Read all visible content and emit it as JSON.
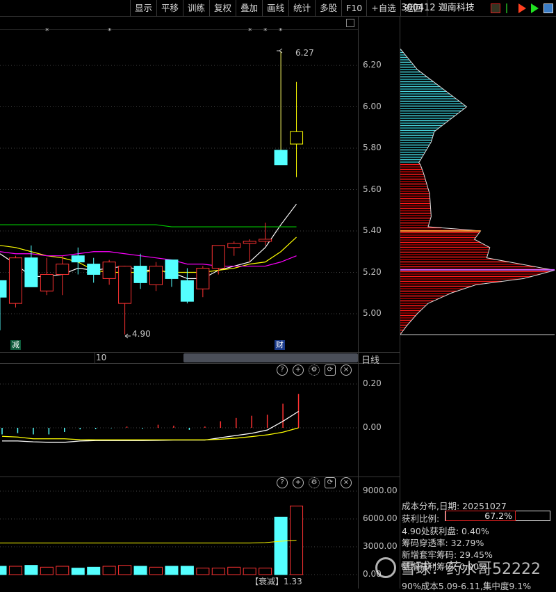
{
  "toolbar": {
    "buttons": [
      "显示",
      "平移",
      "训练",
      "复权",
      "叠加",
      "画线",
      "统计",
      "多股",
      "F10",
      "+自选",
      "返回"
    ],
    "stock": "300412 迦南科技",
    "icons": [
      "chip-distribution-icon",
      "flag-green-icon",
      "flag-red-icon",
      "flag-green-play-icon",
      "window-icon"
    ]
  },
  "main": {
    "price_axis": [
      "6.20",
      "6.00",
      "5.80",
      "5.60",
      "5.40",
      "5.20",
      "5.00"
    ],
    "high_label": "6.27",
    "low_label": "4.90",
    "badge_left": "减",
    "badge_right": "财",
    "stars": [
      "*",
      "*",
      "*",
      "*",
      "*"
    ],
    "date_tick": "10",
    "period": "日线",
    "colors": {
      "up": "#ff3232",
      "down": "#54ffff",
      "ma5": "#ffffff",
      "ma10": "#ffff00",
      "ma20": "#ff00ff",
      "ma60": "#00cc00"
    }
  },
  "chart_data": [
    {
      "type": "candlestick",
      "title": "300412 迦南科技 日线",
      "ylim": [
        4.87,
        6.3
      ],
      "ohlc": [
        [
          5.16,
          5.16,
          4.92,
          5.08
        ],
        [
          5.05,
          5.28,
          5.03,
          5.27
        ],
        [
          5.27,
          5.33,
          5.13,
          5.13
        ],
        [
          5.11,
          5.27,
          5.09,
          5.19
        ],
        [
          5.19,
          5.28,
          5.09,
          5.24
        ],
        [
          5.28,
          5.32,
          5.19,
          5.25
        ],
        [
          5.24,
          5.27,
          5.15,
          5.19
        ],
        [
          5.17,
          5.26,
          5.14,
          5.25
        ],
        [
          5.05,
          5.23,
          4.9,
          5.23
        ],
        [
          5.23,
          5.29,
          5.12,
          5.15
        ],
        [
          5.14,
          5.25,
          5.11,
          5.23
        ],
        [
          5.26,
          5.26,
          5.13,
          5.17
        ],
        [
          5.16,
          5.22,
          5.05,
          5.06
        ],
        [
          5.12,
          5.23,
          5.08,
          5.22
        ],
        [
          5.22,
          5.33,
          5.19,
          5.33
        ],
        [
          5.32,
          5.35,
          5.28,
          5.34
        ],
        [
          5.34,
          5.36,
          5.25,
          5.35
        ],
        [
          5.35,
          5.44,
          5.33,
          5.36
        ],
        [
          5.79,
          6.27,
          5.72,
          5.72
        ],
        [
          5.82,
          6.12,
          5.66,
          5.88
        ]
      ],
      "series": [
        {
          "name": "MA5",
          "values": [
            5.29,
            5.24,
            5.18,
            5.18,
            5.19,
            5.22,
            5.21,
            5.22,
            5.23,
            5.21,
            5.21,
            5.2,
            5.17,
            5.17,
            5.21,
            5.23,
            5.25,
            5.32,
            5.43,
            5.53
          ]
        },
        {
          "name": "MA10",
          "values": [
            5.33,
            5.32,
            5.3,
            5.28,
            5.27,
            5.25,
            5.21,
            5.2,
            5.2,
            5.2,
            5.21,
            5.2,
            5.2,
            5.2,
            5.21,
            5.22,
            5.24,
            5.25,
            5.3,
            5.37
          ]
        },
        {
          "name": "MA20",
          "values": [
            5.3,
            5.29,
            5.29,
            5.28,
            5.28,
            5.29,
            5.3,
            5.3,
            5.29,
            5.28,
            5.27,
            5.26,
            5.24,
            5.24,
            5.23,
            5.23,
            5.23,
            5.23,
            5.25,
            5.28
          ]
        },
        {
          "name": "MA60",
          "values": [
            5.43,
            5.43,
            5.43,
            5.43,
            5.43,
            5.43,
            5.43,
            5.43,
            5.43,
            5.43,
            5.43,
            5.42,
            5.42,
            5.42,
            5.42,
            5.42,
            5.42,
            5.42,
            5.42,
            5.42
          ]
        }
      ]
    },
    {
      "type": "bar",
      "title": "indicator",
      "ylim": [
        -0.11,
        0.25
      ],
      "ticks": [
        "0.20",
        "0.00"
      ],
      "values": [
        -0.03,
        -0.024,
        -0.03,
        -0.03,
        -0.019,
        -0.007,
        -0.006,
        -0.002,
        0.006,
        -0.004,
        0.014,
        0.01,
        -0.009,
        0.006,
        0.03,
        0.045,
        0.055,
        0.06,
        0.11,
        0.155
      ],
      "series": [
        {
          "name": "white",
          "values": [
            -0.06,
            -0.06,
            -0.064,
            -0.066,
            -0.066,
            -0.06,
            -0.058,
            -0.058,
            -0.058,
            -0.058,
            -0.057,
            -0.056,
            -0.056,
            -0.056,
            -0.045,
            -0.035,
            -0.025,
            -0.01,
            0.03,
            0.075
          ]
        },
        {
          "name": "yellow",
          "values": [
            -0.039,
            -0.042,
            -0.05,
            -0.05,
            -0.05,
            -0.054,
            -0.055,
            -0.055,
            -0.055,
            -0.055,
            -0.055,
            -0.055,
            -0.055,
            -0.055,
            -0.052,
            -0.047,
            -0.04,
            -0.032,
            -0.02,
            0.0
          ]
        }
      ]
    },
    {
      "type": "bar",
      "title": "volume",
      "ylim": [
        0,
        9000
      ],
      "ticks": [
        "9000.00",
        "6000.00",
        "3000.00",
        "0.00"
      ],
      "values": [
        900,
        900,
        1000,
        800,
        900,
        700,
        800,
        900,
        1000,
        900,
        800,
        900,
        900,
        700,
        700,
        800,
        700,
        700,
        6200,
        7400
      ],
      "series": [
        {
          "name": "MAVOL",
          "values": [
            3400,
            3400,
            3400,
            3400,
            3400,
            3400,
            3400,
            3400,
            3400,
            3400,
            3400,
            3400,
            3400,
            3400,
            3400,
            3400,
            3400,
            3450,
            3600,
            3700
          ]
        }
      ],
      "label": "【衰减】1.33"
    },
    {
      "type": "area",
      "title": "成本分布",
      "price": [
        6.28,
        6.18,
        6.0,
        5.88,
        5.83,
        5.73,
        5.72,
        5.68,
        5.58,
        5.47,
        5.42,
        5.41,
        5.4,
        5.36,
        5.32,
        5.27,
        5.21,
        5.17,
        5.14,
        5.1,
        5.05,
        5.0,
        4.94,
        4.9
      ],
      "weight": [
        0,
        0.11,
        0.43,
        0.22,
        0.2,
        0.12,
        0.13,
        0.15,
        0.19,
        0.2,
        0.18,
        0.36,
        0.52,
        0.48,
        0.58,
        0.56,
        1.0,
        0.8,
        0.49,
        0.33,
        0.18,
        0.11,
        0.04,
        0
      ],
      "current_price": 5.73
    }
  ],
  "chip": {
    "date_line": "成本分布,日期: 20251027",
    "profit_label": "获利比例:",
    "profit_value": "67.2%",
    "profit_ratio": 0.672,
    "rows": [
      "4.90处获利盘: 0.40%",
      "筹码穿透率: 32.79%",
      "新增套牢筹码: 29.45%",
      "新增获利筹码: 0.00%"
    ],
    "last_row": "90%成本5.09-6.11,集中度9.1%"
  },
  "watermark": "雪球：药水哥52222"
}
